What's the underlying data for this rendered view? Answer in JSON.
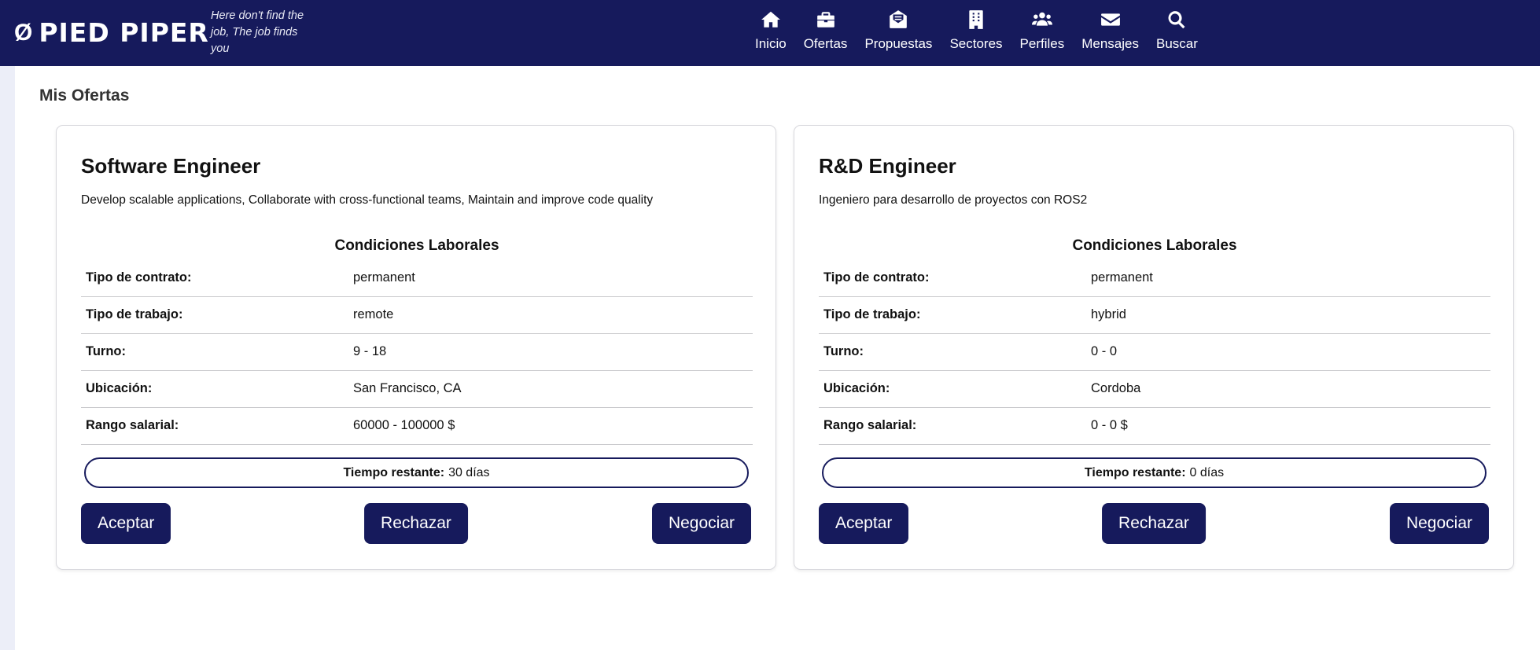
{
  "brand": {
    "symbol": "Ø",
    "name": "PIED PIPER",
    "slogan": "Here don't find the job, The job finds you"
  },
  "nav": [
    {
      "label": "Inicio",
      "icon": "home-icon"
    },
    {
      "label": "Ofertas",
      "icon": "briefcase-icon"
    },
    {
      "label": "Propuestas",
      "icon": "envelope-open-icon"
    },
    {
      "label": "Sectores",
      "icon": "building-icon"
    },
    {
      "label": "Perfiles",
      "icon": "users-icon"
    },
    {
      "label": "Mensajes",
      "icon": "envelope-icon"
    },
    {
      "label": "Buscar",
      "icon": "search-icon"
    }
  ],
  "page": {
    "title": "Mis Ofertas"
  },
  "offers": [
    {
      "title": "Software Engineer",
      "description": "Develop scalable applications, Collaborate with cross-functional teams, Maintain and improve code quality",
      "conditions_title": "Condiciones Laborales",
      "conditions": [
        {
          "label": "Tipo de contrato:",
          "value": "permanent"
        },
        {
          "label": "Tipo de trabajo:",
          "value": "remote"
        },
        {
          "label": "Turno:",
          "value": "9 - 18"
        },
        {
          "label": "Ubicación:",
          "value": "San Francisco, CA"
        },
        {
          "label": "Rango salarial:",
          "value": "60000 - 100000 $"
        }
      ],
      "time_label": "Tiempo restante:",
      "time_value": "30 días",
      "buttons": {
        "accept": "Aceptar",
        "reject": "Rechazar",
        "negotiate": "Negociar"
      }
    },
    {
      "title": "R&D Engineer",
      "description": "Ingeniero para desarrollo de proyectos con ROS2",
      "conditions_title": "Condiciones Laborales",
      "conditions": [
        {
          "label": "Tipo de contrato:",
          "value": "permanent"
        },
        {
          "label": "Tipo de trabajo:",
          "value": "hybrid"
        },
        {
          "label": "Turno:",
          "value": "0 - 0"
        },
        {
          "label": "Ubicación:",
          "value": "Cordoba"
        },
        {
          "label": "Rango salarial:",
          "value": "0 - 0 $"
        }
      ],
      "time_label": "Tiempo restante:",
      "time_value": "0 días",
      "buttons": {
        "accept": "Aceptar",
        "reject": "Rechazar",
        "negotiate": "Negociar"
      }
    }
  ],
  "colors": {
    "navbar": "#161a5c",
    "button": "#161a5c",
    "background": "#eceef8"
  }
}
